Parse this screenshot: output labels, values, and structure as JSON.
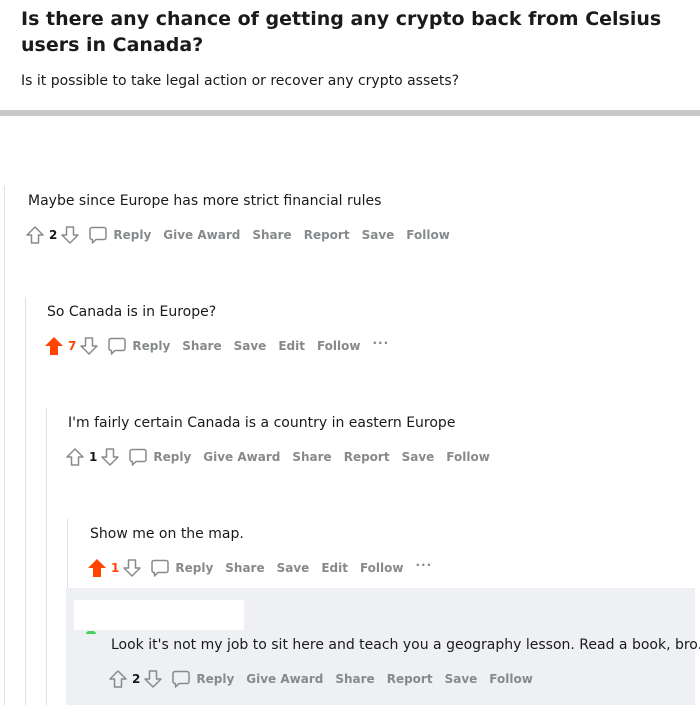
{
  "post": {
    "title": "Is there any chance of getting any crypto back from Celsius users in Canada?",
    "body": "Is it possible to take legal action or recover any crypto assets?"
  },
  "comments": [
    {
      "text": "Maybe since Europe has more strict financial rules",
      "score": "2",
      "upvoted": false,
      "actions": [
        "Reply",
        "Give Award",
        "Share",
        "Report",
        "Save",
        "Follow"
      ],
      "has_more": false
    },
    {
      "text": "So Canada is in Europe?",
      "score": "7",
      "upvoted": true,
      "actions": [
        "Reply",
        "Share",
        "Save",
        "Edit",
        "Follow"
      ],
      "has_more": true
    },
    {
      "text": "I'm fairly certain Canada is a country in eastern Europe",
      "score": "1",
      "upvoted": false,
      "actions": [
        "Reply",
        "Give Award",
        "Share",
        "Report",
        "Save",
        "Follow"
      ],
      "has_more": false
    },
    {
      "text": "Show me on the map.",
      "score": "1",
      "upvoted": true,
      "actions": [
        "Reply",
        "Share",
        "Save",
        "Edit",
        "Follow"
      ],
      "has_more": true
    },
    {
      "text": "Look it's not my job to sit here and teach you a geography lesson. Read a book, bro.",
      "score": "2",
      "upvoted": false,
      "actions": [
        "Reply",
        "Give Award",
        "Share",
        "Report",
        "Save",
        "Follow"
      ],
      "has_more": false
    }
  ],
  "more_label": "···",
  "colors": {
    "upvote_active": "#ff4500",
    "action_text": "#878a8c",
    "thread_line": "#e0e0e0",
    "highlight_bg": "#eef0f4"
  },
  "icons": {
    "upvote": "upvote-arrow-icon",
    "downvote": "downvote-arrow-icon",
    "reply": "speech-bubble-icon"
  }
}
